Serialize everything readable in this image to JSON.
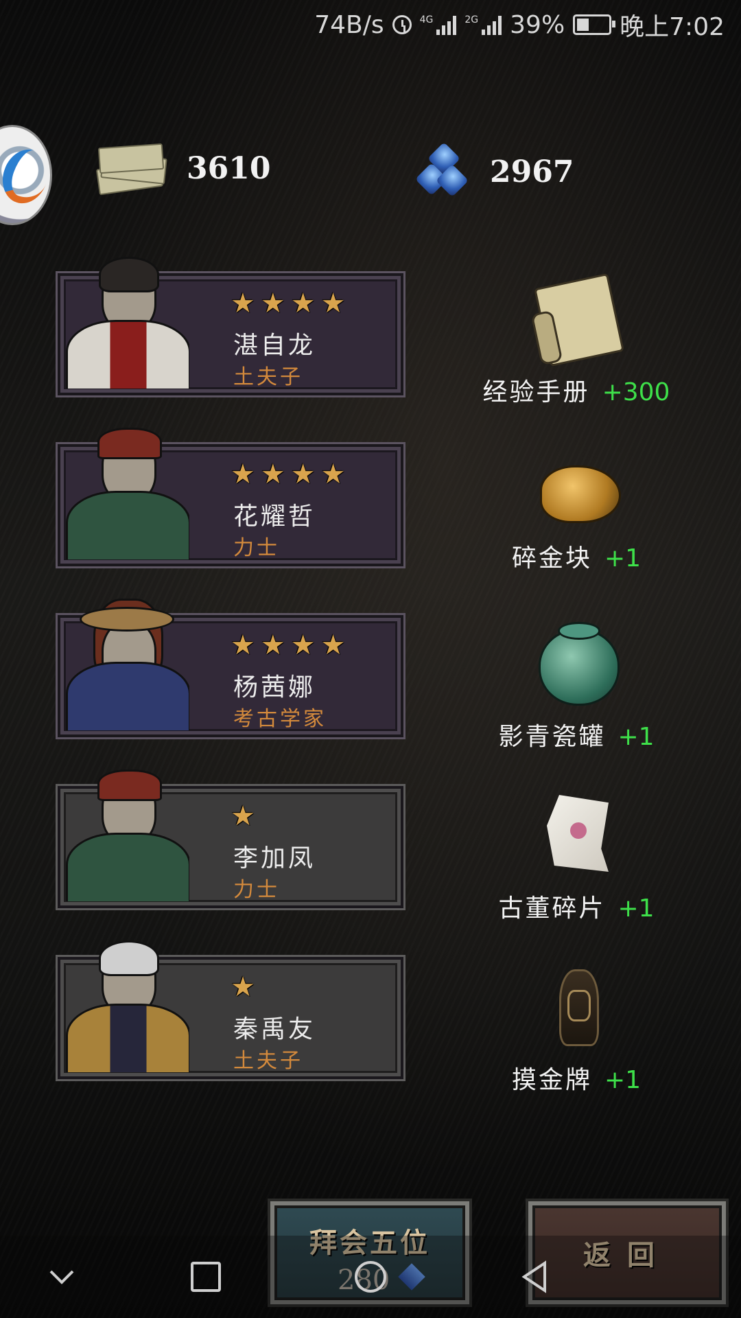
{
  "status_bar": {
    "net_speed": "74B/s",
    "network1": "4G",
    "network2": "2G",
    "battery": "39%",
    "battery_level": 0.39,
    "time": "晚上7:02"
  },
  "currencies": {
    "cash": "3610",
    "gems": "2967"
  },
  "heroes": [
    {
      "name": "湛自龙",
      "class": "土夫子",
      "stars": "★★★★",
      "rarity": "purple"
    },
    {
      "name": "花耀哲",
      "class": "力士",
      "stars": "★★★★",
      "rarity": "purple"
    },
    {
      "name": "杨茜娜",
      "class": "考古学家",
      "stars": "★★★★",
      "rarity": "purple"
    },
    {
      "name": "李加凤",
      "class": "力士",
      "stars": "★",
      "rarity": "grey"
    },
    {
      "name": "秦禹友",
      "class": "土夫子",
      "stars": "★",
      "rarity": "grey"
    }
  ],
  "rewards": [
    {
      "name": "经验手册",
      "qty": "+300",
      "icon": "scroll-icon"
    },
    {
      "name": "碎金块",
      "qty": "+1",
      "icon": "gold-nugget-icon"
    },
    {
      "name": "影青瓷罐",
      "qty": "+1",
      "icon": "porcelain-jar-icon"
    },
    {
      "name": "古董碎片",
      "qty": "+1",
      "icon": "antique-shard-icon"
    },
    {
      "name": "摸金牌",
      "qty": "+1",
      "icon": "gold-touch-amulet-icon"
    }
  ],
  "buttons": {
    "worship": "拜会五位",
    "worship_cost": "280",
    "back": "返回"
  },
  "colors": {
    "star": "#d9a44d",
    "hero_class": "#d48a3c",
    "quantity": "#3ee04a"
  }
}
